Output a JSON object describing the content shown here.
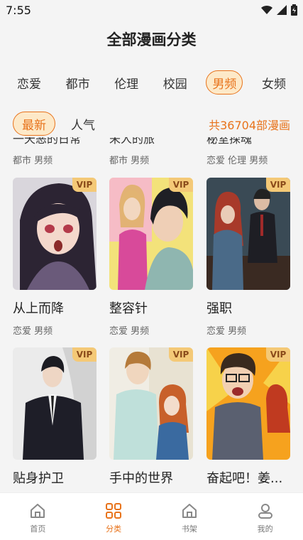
{
  "status": {
    "time": "7:55"
  },
  "page_title": "全部漫画分类",
  "categories": [
    "恋爱",
    "都市",
    "伦理",
    "校园",
    "男频",
    "女频"
  ],
  "active_category": "男频",
  "sort": {
    "options": [
      "最新",
      "人气"
    ],
    "active": "最新"
  },
  "total": "共36704部漫画",
  "partial_row": [
    {
      "title": "一天恶的日常",
      "genres": "都市 男频"
    },
    {
      "title": "未人的旅",
      "genres": "都市 男频"
    },
    {
      "title": "秘室探魂",
      "genres": "恋爱 伦理 男频"
    }
  ],
  "comics": [
    {
      "title": "从上而降",
      "genres": "恋爱 男频",
      "badge": "VIP"
    },
    {
      "title": "整容针",
      "genres": "恋爱 男频",
      "badge": "VIP"
    },
    {
      "title": "强职",
      "genres": "恋爱 男频",
      "badge": "VIP"
    },
    {
      "title": "贴身护卫",
      "genres": "",
      "badge": "VIP"
    },
    {
      "title": "手中的世界",
      "genres": "",
      "badge": "VIP"
    },
    {
      "title": "奋起吧！姜...",
      "genres": "",
      "badge": "VIP"
    }
  ],
  "tabs": [
    {
      "label": "首页",
      "icon": "home-icon"
    },
    {
      "label": "分类",
      "icon": "grid-icon"
    },
    {
      "label": "书架",
      "icon": "bookshelf-icon"
    },
    {
      "label": "我的",
      "icon": "user-icon"
    }
  ],
  "active_tab": "分类",
  "colors": {
    "accent": "#e8731b",
    "accent_bg": "#fde9c8",
    "vip_bg": "#f4c977"
  }
}
